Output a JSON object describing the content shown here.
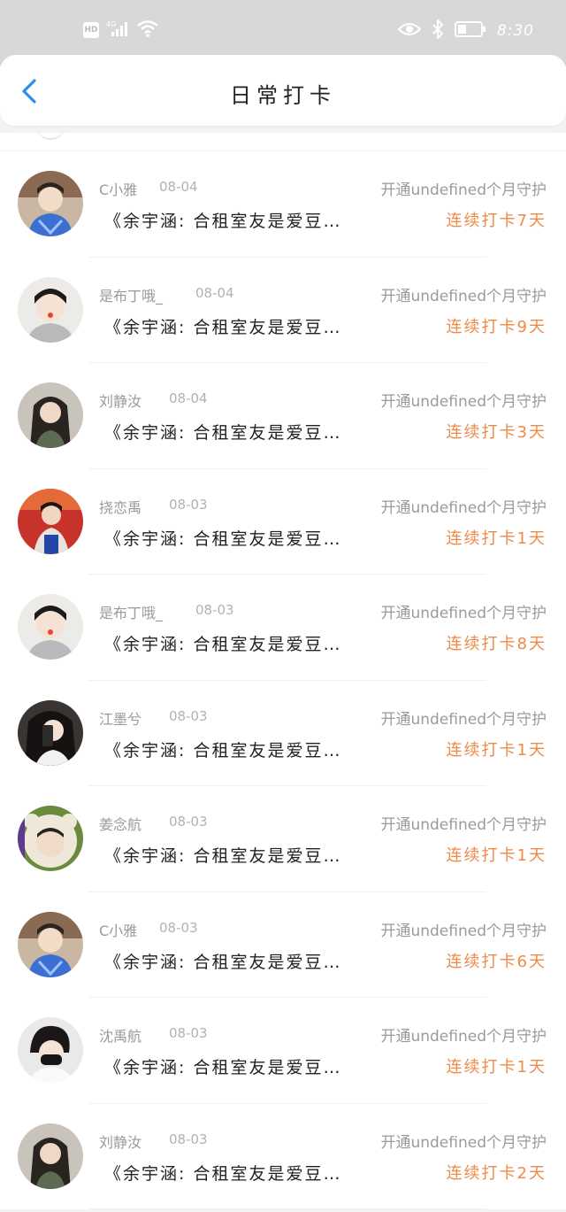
{
  "status_bar": {
    "hd": "HD",
    "network": "4G",
    "time": "8:30",
    "icons": [
      "hd-icon",
      "signal-icon",
      "wifi-icon",
      "eye-icon",
      "bluetooth-icon",
      "battery-icon"
    ]
  },
  "header": {
    "title": "日常打卡",
    "back_icon": "chevron-left-icon"
  },
  "colors": {
    "accent_blue": "#2d8cf0",
    "streak_orange": "#ee8a48",
    "muted_text": "#9a9a9a"
  },
  "checkins": [
    {
      "name": "C小雅",
      "date": "08-04",
      "guard": "开通undefined个月守护",
      "post": "《余宇涵: 合租室友是爱豆…",
      "streak": "连续打卡7天"
    },
    {
      "name": "是布丁哦_",
      "date": "08-04",
      "guard": "开通undefined个月守护",
      "post": "《余宇涵: 合租室友是爱豆…",
      "streak": "连续打卡9天"
    },
    {
      "name": "刘静汝",
      "date": "08-04",
      "guard": "开通undefined个月守护",
      "post": "《余宇涵: 合租室友是爱豆…",
      "streak": "连续打卡3天"
    },
    {
      "name": "挠恋禹",
      "date": "08-03",
      "guard": "开通undefined个月守护",
      "post": "《余宇涵: 合租室友是爱豆…",
      "streak": "连续打卡1天"
    },
    {
      "name": "是布丁哦_",
      "date": "08-03",
      "guard": "开通undefined个月守护",
      "post": "《余宇涵: 合租室友是爱豆…",
      "streak": "连续打卡8天"
    },
    {
      "name": "江墨兮",
      "date": "08-03",
      "guard": "开通undefined个月守护",
      "post": "《余宇涵: 合租室友是爱豆…",
      "streak": "连续打卡1天"
    },
    {
      "name": "姜念航",
      "date": "08-03",
      "guard": "开通undefined个月守护",
      "post": "《余宇涵: 合租室友是爱豆…",
      "streak": "连续打卡1天"
    },
    {
      "name": "C小雅",
      "date": "08-03",
      "guard": "开通undefined个月守护",
      "post": "《余宇涵: 合租室友是爱豆…",
      "streak": "连续打卡6天"
    },
    {
      "name": "沈禹航",
      "date": "08-03",
      "guard": "开通undefined个月守护",
      "post": "《余宇涵: 合租室友是爱豆…",
      "streak": "连续打卡1天"
    },
    {
      "name": "刘静汝",
      "date": "08-03",
      "guard": "开通undefined个月守护",
      "post": "《余宇涵: 合租室友是爱豆…",
      "streak": "连续打卡2天"
    }
  ]
}
